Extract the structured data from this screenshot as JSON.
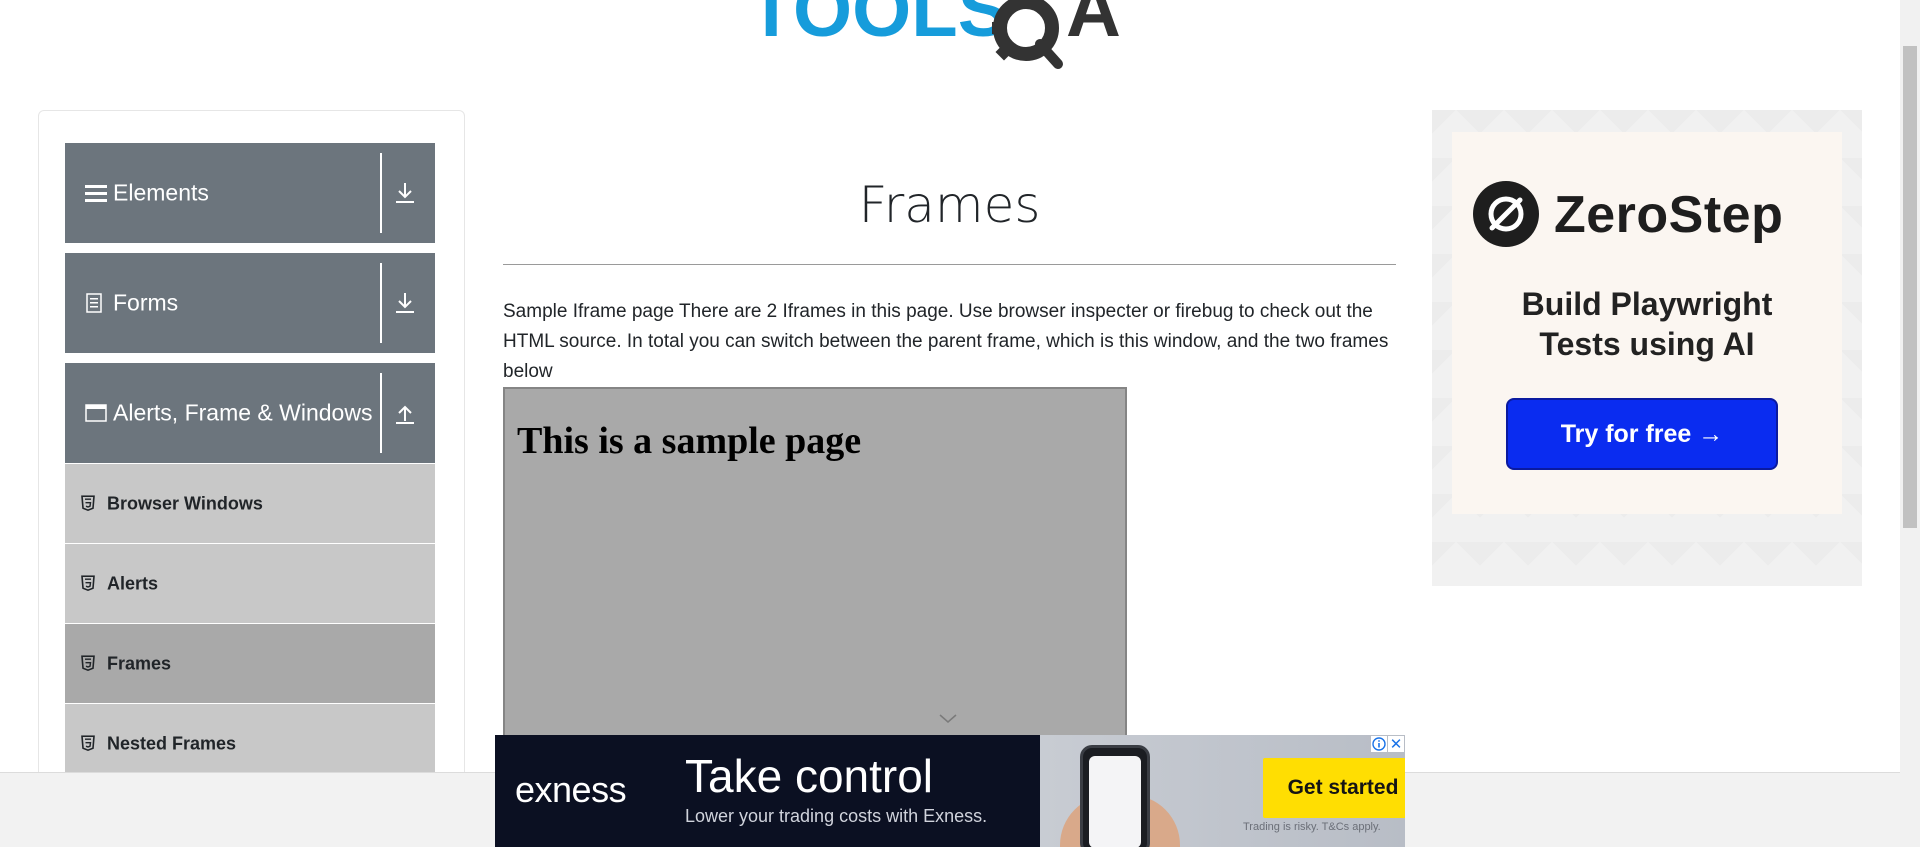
{
  "brand": {
    "logo_text_left": "TOOLS",
    "logo_text_right": "QA",
    "logo_left_color": "#169cdb",
    "logo_right_color": "#333333"
  },
  "sidebar": {
    "groups": [
      {
        "label": "Elements",
        "icon": "hamburger-icon",
        "arrow": "download-icon",
        "expanded": false
      },
      {
        "label": "Forms",
        "icon": "document-icon",
        "arrow": "download-icon",
        "expanded": false
      },
      {
        "label": "Alerts, Frame & Windows",
        "icon": "window-icon",
        "arrow": "upload-icon",
        "expanded": true
      }
    ],
    "sub_items": [
      {
        "label": "Browser Windows",
        "icon": "html5-icon",
        "active": false
      },
      {
        "label": "Alerts",
        "icon": "html5-icon",
        "active": false
      },
      {
        "label": "Frames",
        "icon": "html5-icon",
        "active": true
      },
      {
        "label": "Nested Frames",
        "icon": "html5-icon",
        "active": false
      }
    ],
    "header_color": "#6c757d",
    "item_color": "#c8c8c8",
    "active_item_color": "#a9a9a9"
  },
  "main": {
    "title": "Frames",
    "description": "Sample Iframe page There are 2 Iframes in this page. Use browser inspecter or firebug to check out the HTML source. In total you can switch between the parent frame, which is this window, and the two frames below",
    "iframe": {
      "heading": "This is a sample page",
      "background": "#a9a9a9"
    }
  },
  "right_ad": {
    "brand": "ZeroStep",
    "headline_line1": "Build Playwright",
    "headline_line2": "Tests using AI",
    "cta": "Try for free →",
    "cta_color": "#0a2cf0"
  },
  "bottom_ad": {
    "brand": "exness",
    "headline": "Take control",
    "subtext": "Lower your trading costs with Exness.",
    "cta": "Get started",
    "disclaimer": "Trading is risky. T&Cs apply.",
    "info_icon": "info-icon",
    "close_label": "✕",
    "cta_color": "#ffde02"
  }
}
